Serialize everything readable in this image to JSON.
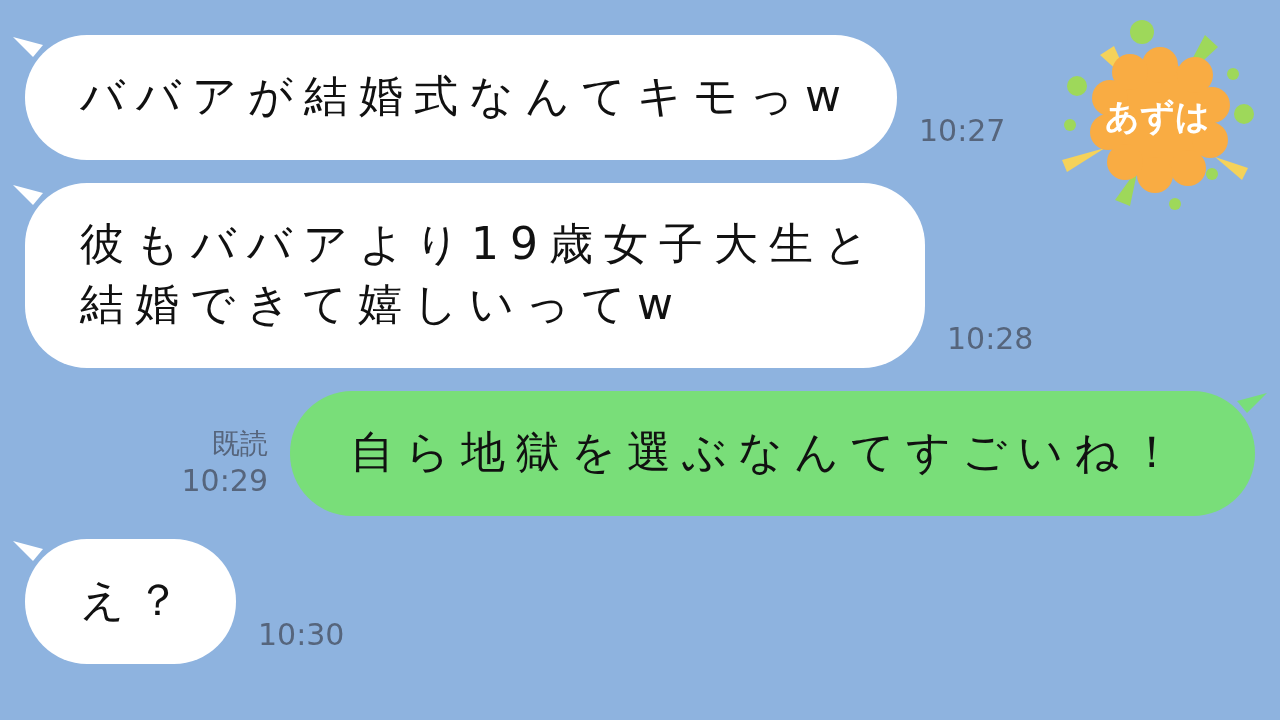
{
  "contact": {
    "name": "あずは"
  },
  "messages": [
    {
      "kind": "received",
      "lines": [
        "ババアが結婚式なんてキモっw"
      ],
      "time": "10:27"
    },
    {
      "kind": "received",
      "lines": [
        "彼もババアより19歳女子大生と",
        "結婚できて嬉しいってw"
      ],
      "time": "10:28"
    },
    {
      "kind": "sent",
      "lines": [
        "自ら地獄を選ぶなんてすごいね！"
      ],
      "time": "10:29",
      "read_label": "既読"
    },
    {
      "kind": "received",
      "lines": [
        "え？"
      ],
      "time": "10:30"
    }
  ]
}
